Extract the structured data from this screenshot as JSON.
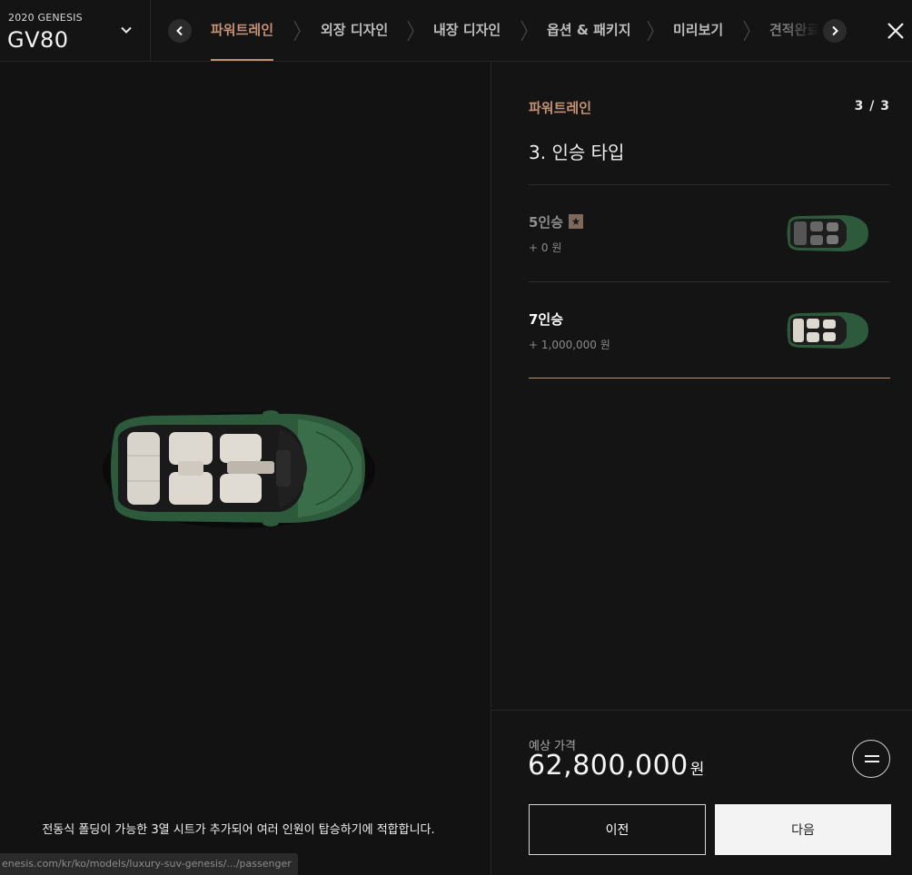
{
  "header": {
    "model_year": "2020 GENESIS",
    "model_name": "GV80",
    "tabs": [
      {
        "label": "파워트레인"
      },
      {
        "label": "외장 디자인"
      },
      {
        "label": "내장 디자인"
      },
      {
        "label": "옵션 & 패키지"
      },
      {
        "label": "미리보기"
      },
      {
        "label": "견적완료"
      }
    ]
  },
  "viewer": {
    "caption": "전동식 폴딩이 가능한 3열 시트가 추가되어 여러 인원이 탑승하기에 적합합니다.",
    "status_url": "enesis.com/kr/ko/models/luxury-suv-genesis/.../passenger"
  },
  "panel": {
    "section_label": "파워트레인",
    "step_count": "3 / 3",
    "step_title": "3. 인승 타입",
    "options": [
      {
        "name": "5인승",
        "price": "+ 0 원",
        "selected": false
      },
      {
        "name": "7인승",
        "price": "+ 1,000,000 원",
        "selected": true
      }
    ],
    "price_label": "예상 가격",
    "price_value": "62,800,000",
    "price_unit": "원",
    "prev_label": "이전",
    "next_label": "다음"
  },
  "colors": {
    "accent": "#c39074",
    "background": "#121212",
    "car_body": "#2d5a3b"
  }
}
